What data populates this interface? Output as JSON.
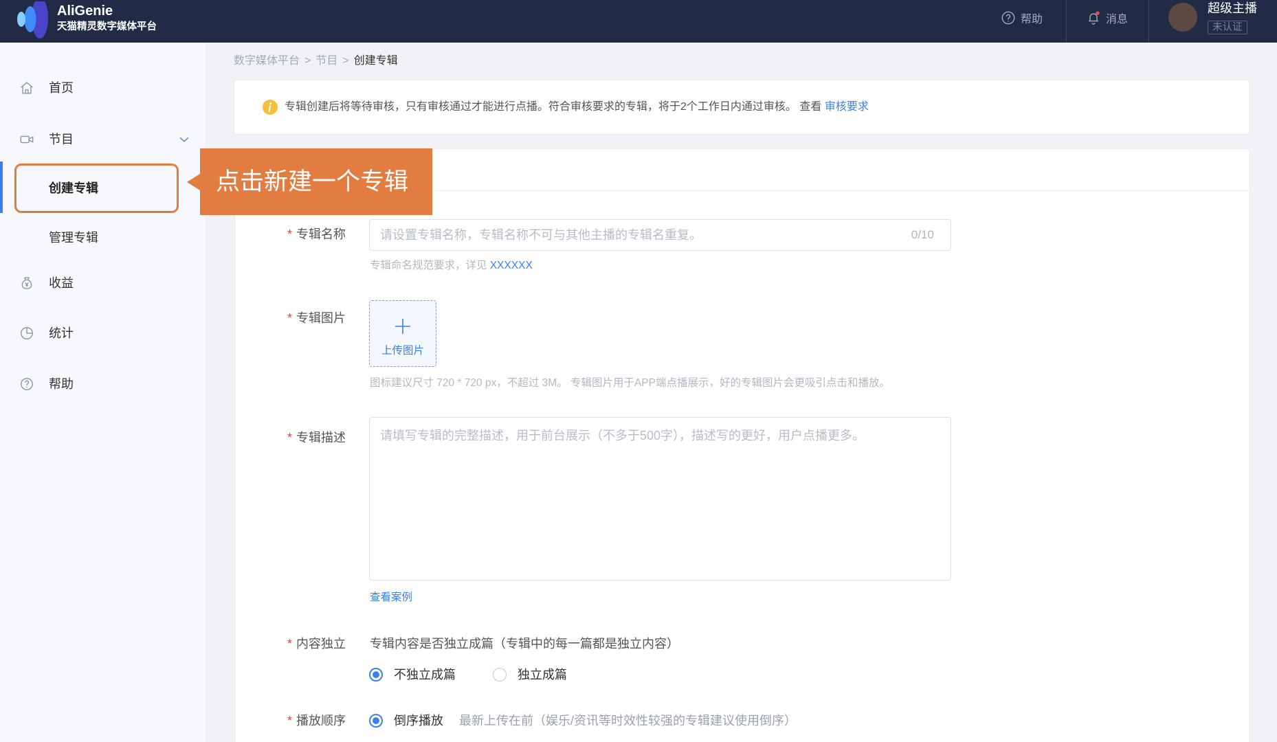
{
  "header": {
    "brand": "AliGenie",
    "subtitle": "天猫精灵数字媒体平台",
    "help_label": "帮助",
    "message_label": "消息",
    "user_name": "超级主播",
    "user_status": "未认证",
    "icons": {
      "help": "help-circle-icon",
      "message": "bell-icon",
      "logo": "sound-wave-logo"
    }
  },
  "sidebar": {
    "items": [
      {
        "label": "首页",
        "icon": "home-icon"
      },
      {
        "label": "节目",
        "icon": "video-icon",
        "expanded": true
      },
      {
        "label": "创建专辑",
        "active": true
      },
      {
        "label": "管理专辑"
      },
      {
        "label": "收益",
        "icon": "money-bag-icon"
      },
      {
        "label": "统计",
        "icon": "pie-chart-icon"
      },
      {
        "label": "帮助",
        "icon": "help-circle-icon"
      }
    ]
  },
  "callout": {
    "text": "点击新建一个专辑"
  },
  "breadcrumb": {
    "separator": ">",
    "items": [
      "数字媒体平台",
      "节目",
      "创建专辑"
    ]
  },
  "notice": {
    "icon": "info-icon",
    "text": "专辑创建后将等待审核，只有审核通过才能进行点播。符合审核要求的专辑，将于2个工作日内通过审核。",
    "view_label": "查看",
    "link_label": "审核要求"
  },
  "form": {
    "required_mark": "*",
    "name": {
      "label": "专辑名称",
      "value": "",
      "placeholder": "请设置专辑名称，专辑名称不可与其他主播的专辑名重复。",
      "counter": "0/10",
      "hint": "专辑命名规范要求，详见",
      "hint_link": "XXXXXX"
    },
    "image": {
      "label": "专辑图片",
      "upload_label": "上传图片",
      "hint": "图标建议尺寸 720 * 720 px，不超过 3M。 专辑图片用于APP端点播展示，好的专辑图片会更吸引点击和播放。"
    },
    "description": {
      "label": "专辑描述",
      "placeholder": "请填写专辑的完整描述，用于前台展示（不多于500字），描述写的更好，用户点播更多。",
      "example_link": "查看案例"
    },
    "independent": {
      "label": "内容独立",
      "question": "专辑内容是否独立成篇（专辑中的每一篇都是独立内容）",
      "options": [
        {
          "label": "不独立成篇",
          "selected": true
        },
        {
          "label": "独立成篇",
          "selected": false
        }
      ]
    },
    "order": {
      "label": "播放顺序",
      "options": [
        {
          "label": "倒序播放",
          "selected": true
        }
      ],
      "note": "最新上传在前（娱乐/资讯等时效性较强的专辑建议使用倒序）"
    }
  },
  "colors": {
    "header_bg": "#222b45",
    "accent": "#3d7ff0",
    "callout": "#e27c41",
    "notice_icon": "#f5be3c",
    "required": "#e0473c"
  }
}
